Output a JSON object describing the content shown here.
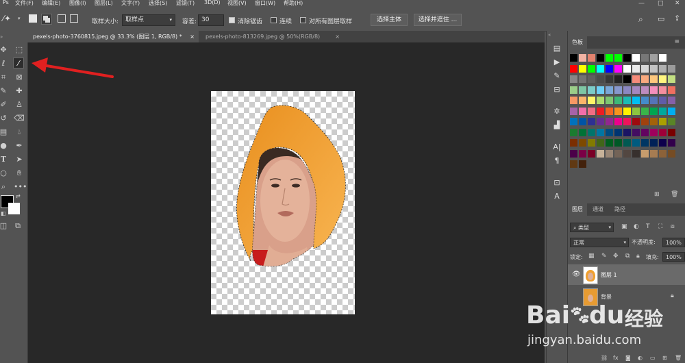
{
  "menubar": {
    "items": [
      "文件(F)",
      "编辑(E)",
      "图像(I)",
      "图层(L)",
      "文字(Y)",
      "选择(S)",
      "滤镜(T)",
      "3D(D)",
      "视图(V)",
      "窗口(W)",
      "帮助(H)"
    ]
  },
  "options": {
    "sample_size_label": "取样大小:",
    "sample_size_value": "取样点",
    "tolerance_label": "容差:",
    "tolerance_value": "30",
    "antialias_label": "消除锯齿",
    "contiguous_label": "连续",
    "all_layers_label": "对所有图层取样",
    "select_subject_label": "选择主体",
    "select_mask_label": "选择并遮住 ..."
  },
  "tabs": [
    {
      "label": "pexels-photo-3760815.jpeg @ 33.3% (图层 1, RGB/8) *",
      "active": true
    },
    {
      "label": "pexels-photo-813269.jpeg @ 50%(RGB/8)",
      "active": false
    }
  ],
  "swatches_panel": {
    "title": "色板",
    "rows": [
      [
        "#000000",
        "#f2b3a3",
        "#e2826e",
        "#000000",
        "#00ff00",
        "#00ff00",
        "#000000",
        "#ffffff",
        "#777777",
        "#a0a0a0",
        "#ffffff"
      ],
      [
        "#ff0000",
        "#ffff00",
        "#00ff00",
        "#00ffff",
        "#0000ff",
        "#ff00ff",
        "#ffffff",
        "#ebebeb",
        "#d7d7d7",
        "#c3c3c3",
        "#afafaf",
        "#9b9b9b"
      ],
      [
        "#878787",
        "#737373",
        "#5f5f5f",
        "#4b4b4b",
        "#373737",
        "#232323",
        "#000000",
        "#f58b7a",
        "#f8a97e",
        "#fdc77d",
        "#fff57f",
        "#c3df82"
      ],
      [
        "#9bcd89",
        "#7ec6a4",
        "#7cccc9",
        "#6ecff6",
        "#7aa7d8",
        "#8797cd",
        "#8b87c1",
        "#a487bf",
        "#bd8cbf",
        "#f48fbd",
        "#f48e9f",
        "#ef6f60"
      ],
      [
        "#f79865",
        "#fbb56a",
        "#fff568",
        "#addc6e",
        "#7dc672",
        "#3cb878",
        "#1cbbb4",
        "#00bff3",
        "#448ccb",
        "#5574b9",
        "#605ca8",
        "#8560a8"
      ],
      [
        "#a763a8",
        "#f06eaa",
        "#f06d84",
        "#ed1c24",
        "#f26522",
        "#f7941d",
        "#fff200",
        "#8dc63f",
        "#39b54a",
        "#00a651",
        "#00a99d",
        "#00aeef"
      ],
      [
        "#0072bc",
        "#0054a6",
        "#2e3192",
        "#662d91",
        "#92278f",
        "#ec008c",
        "#ed145b",
        "#9e0b0f",
        "#a0410d",
        "#a3620a",
        "#aba000",
        "#598527"
      ],
      [
        "#1a7b30",
        "#007236",
        "#00746b",
        "#0076a3",
        "#004a80",
        "#003471",
        "#1b1464",
        "#440e62",
        "#630460",
        "#9e005d",
        "#9e0039",
        "#790000"
      ],
      [
        "#7b2e00",
        "#7d4900",
        "#827b00",
        "#406618",
        "#005e20",
        "#005826",
        "#005952",
        "#005b7f",
        "#003663",
        "#002157",
        "#0d004c",
        "#32004b"
      ],
      [
        "#4b0049",
        "#7b0046",
        "#7a0026",
        "#c7b299",
        "#998675",
        "#736357",
        "#534741",
        "#37302d",
        "#c69c6d",
        "#a67c52",
        "#8c6239",
        "#754c24"
      ],
      [
        "#603913",
        "#42210b"
      ]
    ]
  },
  "layers_panel": {
    "tabs": [
      "图层",
      "通道",
      "路径"
    ],
    "kind_label": "类型",
    "blend_mode": "正常",
    "opacity_label": "不透明度:",
    "opacity_value": "100%",
    "lock_label": "锁定:",
    "fill_label": "填充:",
    "fill_value": "100%",
    "layers": [
      {
        "name": "图层 1",
        "selected": true
      },
      {
        "name": "背景",
        "selected": false
      }
    ]
  },
  "watermark": {
    "brand": "Bai",
    "brand2": "du",
    "suffix": "经验",
    "url": "jingyan.baidu.com"
  },
  "colors": {
    "foreground": "#000000",
    "background": "#ffffff",
    "selection_fill": "#f5a12f",
    "arrow": "#e02020"
  }
}
